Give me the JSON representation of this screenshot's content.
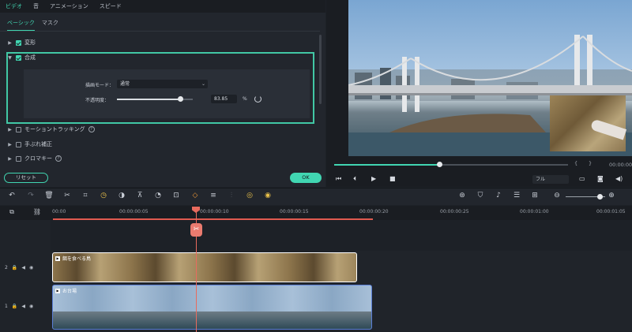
{
  "property_panel": {
    "top_tabs": [
      "ビデオ",
      "音",
      "アニメーション",
      "スピード"
    ],
    "sub_tabs": [
      "ベーシック",
      "マスク"
    ],
    "sections": {
      "transform": "変形",
      "composite": "合成",
      "motion_tracking": "モーショントラッキング",
      "stabilization": "手ぶれ補正",
      "chroma_key": "クロマキー"
    },
    "blend_mode": {
      "label": "描画モード：",
      "value": "通常"
    },
    "opacity": {
      "label": "不透明度：",
      "value": "83.85",
      "unit": "%",
      "level": 0.8385
    },
    "reset_button": "リセット",
    "ok_button": "OK"
  },
  "preview": {
    "progress": 0.45,
    "quality": "フル",
    "time_partial": "00:00:00"
  },
  "timeline": {
    "ruler_labels": [
      "00:00",
      "00:00:00:05",
      "00:00:00:10",
      "00:00:00:15",
      "00:00:00:20",
      "00:00:00:25",
      "00:00:01:00",
      "00:00:01:05"
    ],
    "tracks": [
      {
        "number": "2",
        "clip_title": "餌を食べる鳥"
      },
      {
        "number": "1",
        "clip_title": "お台場"
      }
    ]
  },
  "colors": {
    "accent": "#41d6b2",
    "playhead": "#e86b5e",
    "clip_selected_border": "#5b7fd6"
  }
}
